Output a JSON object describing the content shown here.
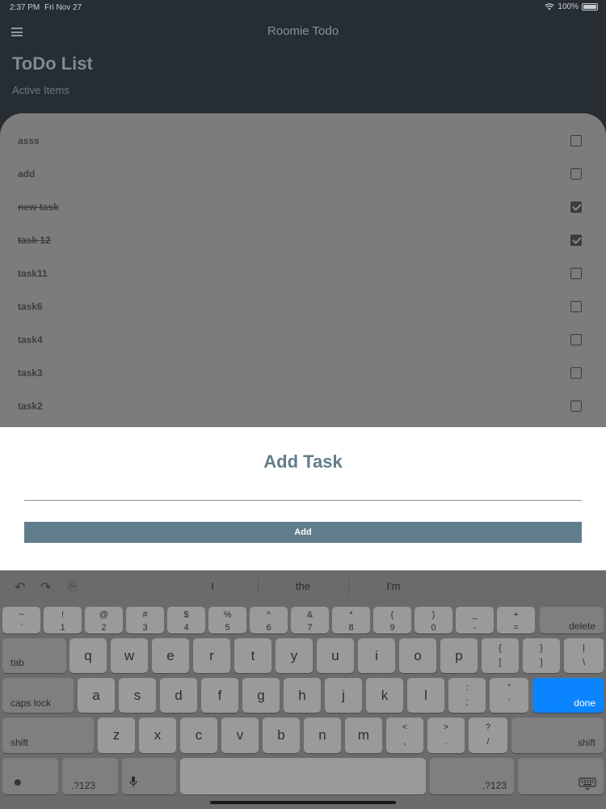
{
  "status": {
    "time": "2:37 PM",
    "date": "Fri Nov 27",
    "battery": "100%"
  },
  "app": {
    "title": "Roomie Todo",
    "page_title": "ToDo List",
    "subtitle": "Active Items"
  },
  "todos": [
    {
      "label": "asss",
      "done": false
    },
    {
      "label": "add",
      "done": false
    },
    {
      "label": "new task",
      "done": true
    },
    {
      "label": "task 12",
      "done": true
    },
    {
      "label": "task11",
      "done": false
    },
    {
      "label": "task6",
      "done": false
    },
    {
      "label": "task4",
      "done": false
    },
    {
      "label": "task3",
      "done": false
    },
    {
      "label": "task2",
      "done": false
    }
  ],
  "sheet": {
    "title": "Add Task",
    "input_value": "",
    "button": "Add"
  },
  "keyboard": {
    "suggestions": [
      "I",
      "the",
      "I'm"
    ],
    "row1": [
      {
        "top": "~",
        "bottom": "`"
      },
      {
        "top": "!",
        "bottom": "1"
      },
      {
        "top": "@",
        "bottom": "2"
      },
      {
        "top": "#",
        "bottom": "3"
      },
      {
        "top": "$",
        "bottom": "4"
      },
      {
        "top": "%",
        "bottom": "5"
      },
      {
        "top": "^",
        "bottom": "6"
      },
      {
        "top": "&",
        "bottom": "7"
      },
      {
        "top": "*",
        "bottom": "8"
      },
      {
        "top": "(",
        "bottom": "9"
      },
      {
        "top": ")",
        "bottom": "0"
      },
      {
        "top": "_",
        "bottom": "-"
      },
      {
        "top": "+",
        "bottom": "="
      }
    ],
    "row2": [
      "q",
      "w",
      "e",
      "r",
      "t",
      "y",
      "u",
      "i",
      "o",
      "p"
    ],
    "row2_sym": [
      {
        "top": "{",
        "bottom": "["
      },
      {
        "top": "}",
        "bottom": "]"
      },
      {
        "top": "|",
        "bottom": "\\"
      }
    ],
    "row3": [
      "a",
      "s",
      "d",
      "f",
      "g",
      "h",
      "j",
      "k",
      "l"
    ],
    "row3_sym": [
      {
        "top": ":",
        "bottom": ";"
      },
      {
        "top": "”",
        "bottom": "’"
      }
    ],
    "row4": [
      "z",
      "x",
      "c",
      "v",
      "b",
      "n",
      "m"
    ],
    "row4_sym": [
      {
        "top": "<",
        "bottom": ","
      },
      {
        "top": ">",
        "bottom": "."
      },
      {
        "top": "?",
        "bottom": "/"
      }
    ],
    "delete": "delete",
    "tab": "tab",
    "caps": "caps lock",
    "done": "done",
    "shift": "shift",
    "numbers": ".?123"
  }
}
